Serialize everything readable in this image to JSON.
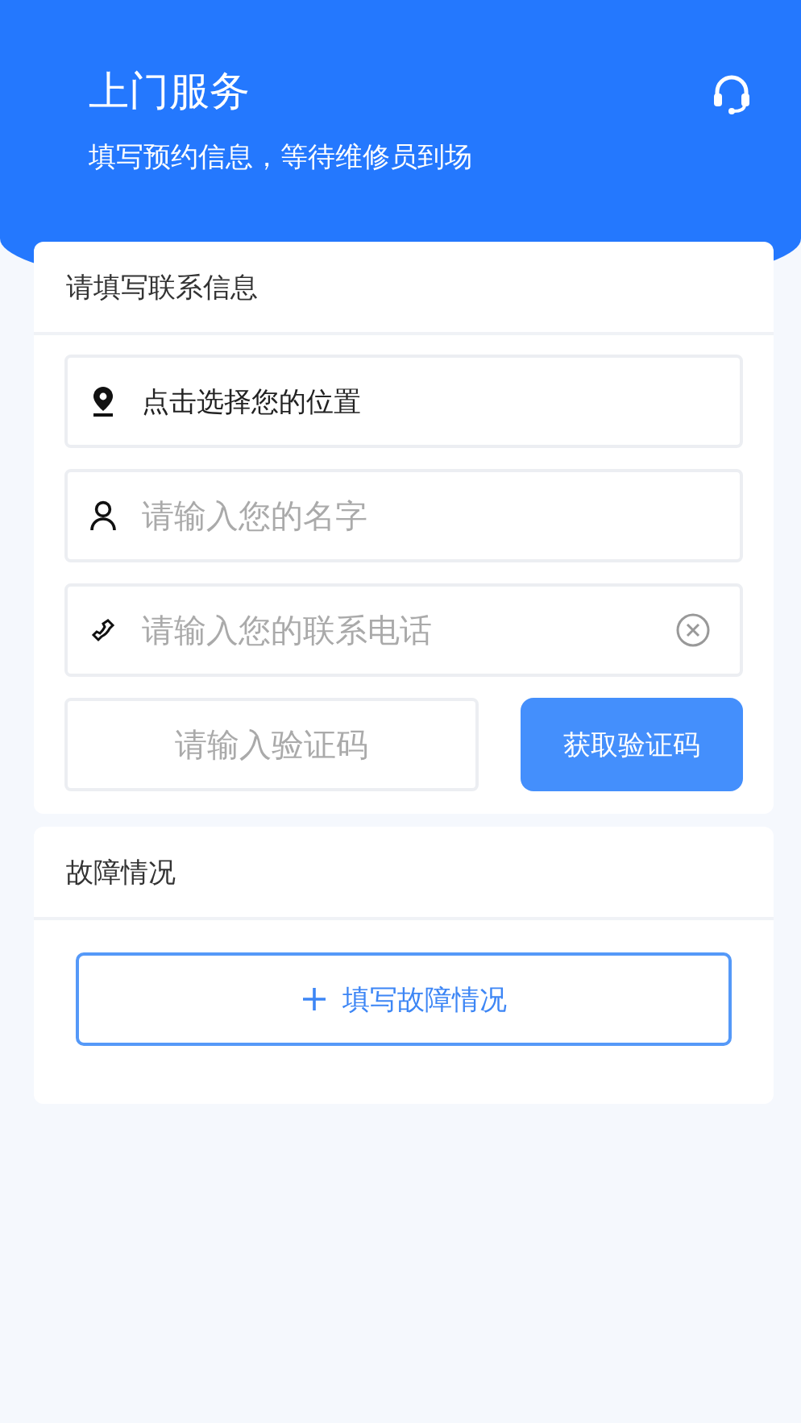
{
  "header": {
    "title": "上门服务",
    "subtitle": "填写预约信息，等待维修员到场"
  },
  "contact_section": {
    "title": "请填写联系信息",
    "fields": [
      {
        "kind": "location",
        "value": "点击选择您的位置",
        "clearable": false
      },
      {
        "kind": "name",
        "placeholder": "请输入您的名字",
        "clearable": false
      },
      {
        "kind": "phone",
        "placeholder": "请输入您的联系电话",
        "clearable": true
      }
    ],
    "code_field": {
      "placeholder": "请输入验证码"
    },
    "code_button": "获取验证码"
  },
  "fault_section": {
    "title": "故障情况",
    "add_button": "填写故障情况"
  }
}
